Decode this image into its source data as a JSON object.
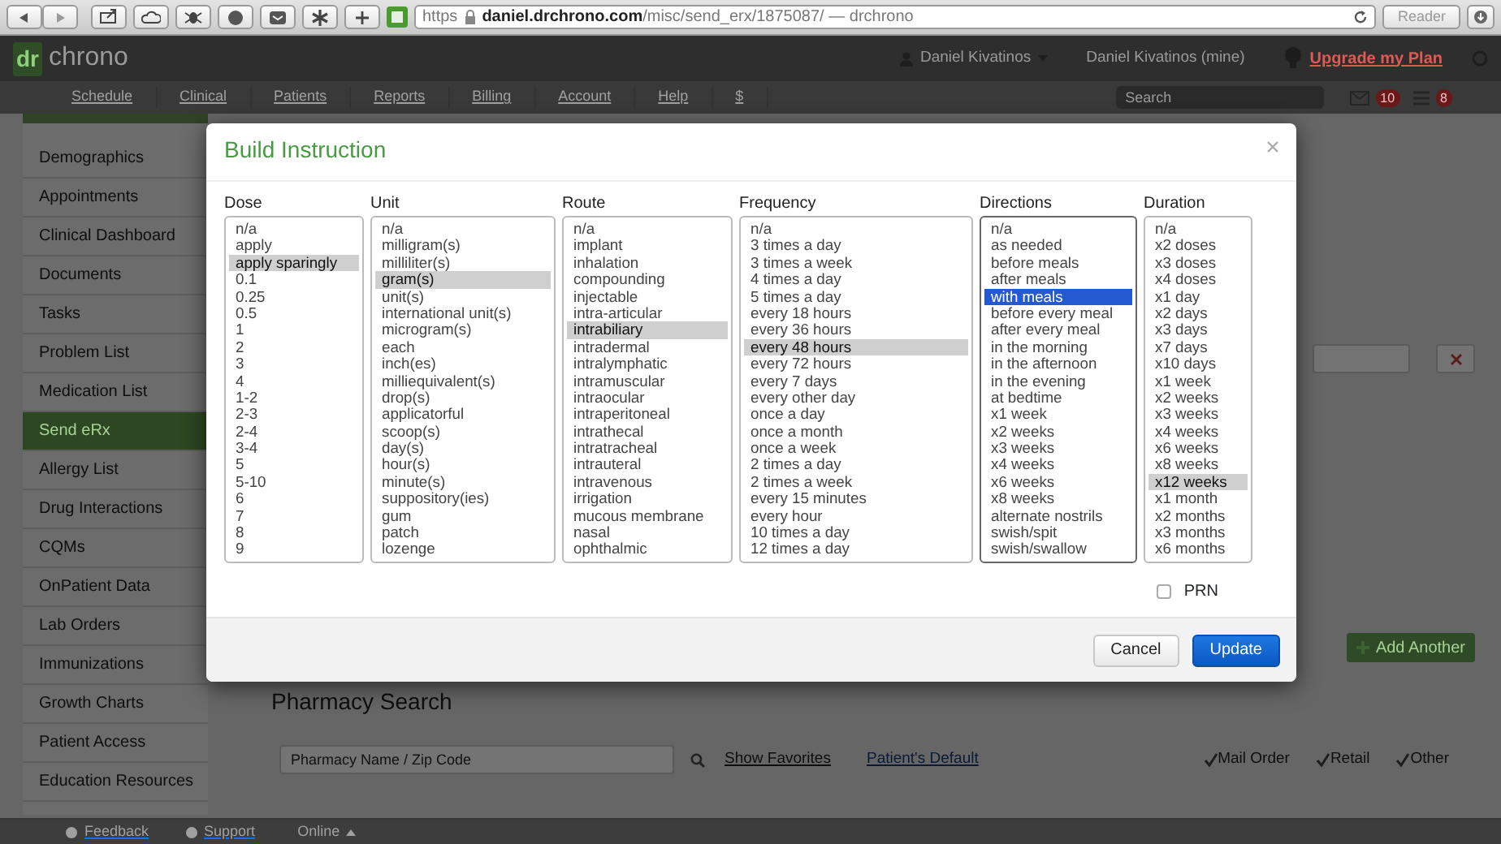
{
  "browser": {
    "url_scheme": "https",
    "url": "**daniel.drchrono.com**/misc/send_erx/1875087/ — drchrono",
    "reader": "Reader"
  },
  "header": {
    "logo_prefix": "dr",
    "logo_text": "chrono",
    "user": "Daniel Kivatinos",
    "account": "Daniel Kivatinos (mine)",
    "upgrade": "Upgrade my Plan"
  },
  "nav": {
    "items": [
      "Schedule",
      "Clinical",
      "Patients",
      "Reports",
      "Billing",
      "Account",
      "Help",
      "$"
    ],
    "search_placeholder": "Search",
    "message_count": "10",
    "task_count": "8"
  },
  "sidebar": {
    "items": [
      {
        "label": "Demographics",
        "selected": false
      },
      {
        "label": "Appointments",
        "selected": false
      },
      {
        "label": "Clinical Dashboard",
        "selected": false
      },
      {
        "label": "Documents",
        "selected": false
      },
      {
        "label": "Tasks",
        "selected": false
      },
      {
        "label": "Problem List",
        "selected": false
      },
      {
        "label": "Medication List",
        "selected": false
      },
      {
        "label": "Send eRx",
        "selected": true
      },
      {
        "label": "Allergy List",
        "selected": false
      },
      {
        "label": "Drug Interactions",
        "selected": false
      },
      {
        "label": "CQMs",
        "selected": false
      },
      {
        "label": "OnPatient Data",
        "selected": false
      },
      {
        "label": "Lab Orders",
        "selected": false
      },
      {
        "label": "Immunizations",
        "selected": false
      },
      {
        "label": "Growth Charts",
        "selected": false
      },
      {
        "label": "Patient Access",
        "selected": false
      },
      {
        "label": "Education Resources",
        "selected": false
      }
    ]
  },
  "modal": {
    "title": "Build Instruction",
    "lists": [
      {
        "label": "Dose",
        "focused": false,
        "options": [
          {
            "text": "n/a",
            "selected": false
          },
          {
            "text": "apply",
            "selected": false
          },
          {
            "text": "apply sparingly",
            "selected": true
          },
          {
            "text": "0.1",
            "selected": false
          },
          {
            "text": "0.25",
            "selected": false
          },
          {
            "text": "0.5",
            "selected": false
          },
          {
            "text": "1",
            "selected": false
          },
          {
            "text": "2",
            "selected": false
          },
          {
            "text": "3",
            "selected": false
          },
          {
            "text": "4",
            "selected": false
          },
          {
            "text": "1-2",
            "selected": false
          },
          {
            "text": "2-3",
            "selected": false
          },
          {
            "text": "2-4",
            "selected": false
          },
          {
            "text": "3-4",
            "selected": false
          },
          {
            "text": "5",
            "selected": false
          },
          {
            "text": "5-10",
            "selected": false
          },
          {
            "text": "6",
            "selected": false
          },
          {
            "text": "7",
            "selected": false
          },
          {
            "text": "8",
            "selected": false
          },
          {
            "text": "9",
            "selected": false
          }
        ]
      },
      {
        "label": "Unit",
        "focused": false,
        "options": [
          {
            "text": "n/a",
            "selected": false
          },
          {
            "text": "milligram(s)",
            "selected": false
          },
          {
            "text": "milliliter(s)",
            "selected": false
          },
          {
            "text": "gram(s)",
            "selected": true
          },
          {
            "text": "unit(s)",
            "selected": false
          },
          {
            "text": "international unit(s)",
            "selected": false
          },
          {
            "text": "microgram(s)",
            "selected": false
          },
          {
            "text": "each",
            "selected": false
          },
          {
            "text": "inch(es)",
            "selected": false
          },
          {
            "text": "milliequivalent(s)",
            "selected": false
          },
          {
            "text": "drop(s)",
            "selected": false
          },
          {
            "text": "applicatorful",
            "selected": false
          },
          {
            "text": "scoop(s)",
            "selected": false
          },
          {
            "text": "day(s)",
            "selected": false
          },
          {
            "text": "hour(s)",
            "selected": false
          },
          {
            "text": "minute(s)",
            "selected": false
          },
          {
            "text": "suppository(ies)",
            "selected": false
          },
          {
            "text": "gum",
            "selected": false
          },
          {
            "text": "patch",
            "selected": false
          },
          {
            "text": "lozenge",
            "selected": false
          }
        ]
      },
      {
        "label": "Route",
        "focused": false,
        "options": [
          {
            "text": "n/a",
            "selected": false
          },
          {
            "text": "implant",
            "selected": false
          },
          {
            "text": "inhalation",
            "selected": false
          },
          {
            "text": "compounding",
            "selected": false
          },
          {
            "text": "injectable",
            "selected": false
          },
          {
            "text": "intra-articular",
            "selected": false
          },
          {
            "text": "intrabiliary",
            "selected": true
          },
          {
            "text": "intradermal",
            "selected": false
          },
          {
            "text": "intralymphatic",
            "selected": false
          },
          {
            "text": "intramuscular",
            "selected": false
          },
          {
            "text": "intraocular",
            "selected": false
          },
          {
            "text": "intraperitoneal",
            "selected": false
          },
          {
            "text": "intrathecal",
            "selected": false
          },
          {
            "text": "intratracheal",
            "selected": false
          },
          {
            "text": "intrauteral",
            "selected": false
          },
          {
            "text": "intravenous",
            "selected": false
          },
          {
            "text": "irrigation",
            "selected": false
          },
          {
            "text": "mucous membrane",
            "selected": false
          },
          {
            "text": "nasal",
            "selected": false
          },
          {
            "text": "ophthalmic",
            "selected": false
          }
        ]
      },
      {
        "label": "Frequency",
        "focused": false,
        "options": [
          {
            "text": "n/a",
            "selected": false
          },
          {
            "text": "3 times a day",
            "selected": false
          },
          {
            "text": "3 times a week",
            "selected": false
          },
          {
            "text": "4 times a day",
            "selected": false
          },
          {
            "text": "5 times a day",
            "selected": false
          },
          {
            "text": "every 18 hours",
            "selected": false
          },
          {
            "text": "every 36 hours",
            "selected": false
          },
          {
            "text": "every 48 hours",
            "selected": true
          },
          {
            "text": "every 72 hours",
            "selected": false
          },
          {
            "text": "every 7 days",
            "selected": false
          },
          {
            "text": "every other day",
            "selected": false
          },
          {
            "text": "once a day",
            "selected": false
          },
          {
            "text": "once a month",
            "selected": false
          },
          {
            "text": "once a week",
            "selected": false
          },
          {
            "text": "2 times a day",
            "selected": false
          },
          {
            "text": "2 times a week",
            "selected": false
          },
          {
            "text": "every 15 minutes",
            "selected": false
          },
          {
            "text": "every hour",
            "selected": false
          },
          {
            "text": "10 times a day",
            "selected": false
          },
          {
            "text": "12 times a day",
            "selected": false
          }
        ]
      },
      {
        "label": "Directions",
        "focused": true,
        "options": [
          {
            "text": "n/a",
            "selected": false
          },
          {
            "text": "as needed",
            "selected": false
          },
          {
            "text": "before meals",
            "selected": false
          },
          {
            "text": "after meals",
            "selected": false
          },
          {
            "text": "with meals",
            "selected": true
          },
          {
            "text": "before every meal",
            "selected": false
          },
          {
            "text": "after every meal",
            "selected": false
          },
          {
            "text": "in the morning",
            "selected": false
          },
          {
            "text": "in the afternoon",
            "selected": false
          },
          {
            "text": "in the evening",
            "selected": false
          },
          {
            "text": "at bedtime",
            "selected": false
          },
          {
            "text": "x1 week",
            "selected": false
          },
          {
            "text": "x2 weeks",
            "selected": false
          },
          {
            "text": "x3 weeks",
            "selected": false
          },
          {
            "text": "x4 weeks",
            "selected": false
          },
          {
            "text": "x6 weeks",
            "selected": false
          },
          {
            "text": "x8 weeks",
            "selected": false
          },
          {
            "text": "alternate nostrils",
            "selected": false
          },
          {
            "text": "swish/spit",
            "selected": false
          },
          {
            "text": "swish/swallow",
            "selected": false
          }
        ]
      },
      {
        "label": "Duration",
        "focused": false,
        "options": [
          {
            "text": "n/a",
            "selected": false
          },
          {
            "text": "x2 doses",
            "selected": false
          },
          {
            "text": "x3 doses",
            "selected": false
          },
          {
            "text": "x4 doses",
            "selected": false
          },
          {
            "text": "x1 day",
            "selected": false
          },
          {
            "text": "x2 days",
            "selected": false
          },
          {
            "text": "x3 days",
            "selected": false
          },
          {
            "text": "x7 days",
            "selected": false
          },
          {
            "text": "x10 days",
            "selected": false
          },
          {
            "text": "x1 week",
            "selected": false
          },
          {
            "text": "x2 weeks",
            "selected": false
          },
          {
            "text": "x3 weeks",
            "selected": false
          },
          {
            "text": "x4 weeks",
            "selected": false
          },
          {
            "text": "x6 weeks",
            "selected": false
          },
          {
            "text": "x8 weeks",
            "selected": false
          },
          {
            "text": "x12 weeks",
            "selected": true
          },
          {
            "text": "x1 month",
            "selected": false
          },
          {
            "text": "x2 months",
            "selected": false
          },
          {
            "text": "x3 months",
            "selected": false
          },
          {
            "text": "x6 months",
            "selected": false
          }
        ]
      }
    ],
    "prn": {
      "label": "PRN",
      "checked": false
    },
    "cancel": "Cancel",
    "update": "Update"
  },
  "page": {
    "heading": "Pharmacy Search",
    "search_placeholder": "Pharmacy Name / Zip Code",
    "links": [
      "Show Favorites",
      "Patient's Default"
    ],
    "filters": [
      {
        "label": "Mail Order",
        "checked": true
      },
      {
        "label": "Retail",
        "checked": true
      },
      {
        "label": "Other",
        "checked": true
      }
    ],
    "add_button": "Add Another"
  },
  "footer": {
    "items": [
      "Feedback",
      "Support"
    ],
    "status": "Online"
  }
}
